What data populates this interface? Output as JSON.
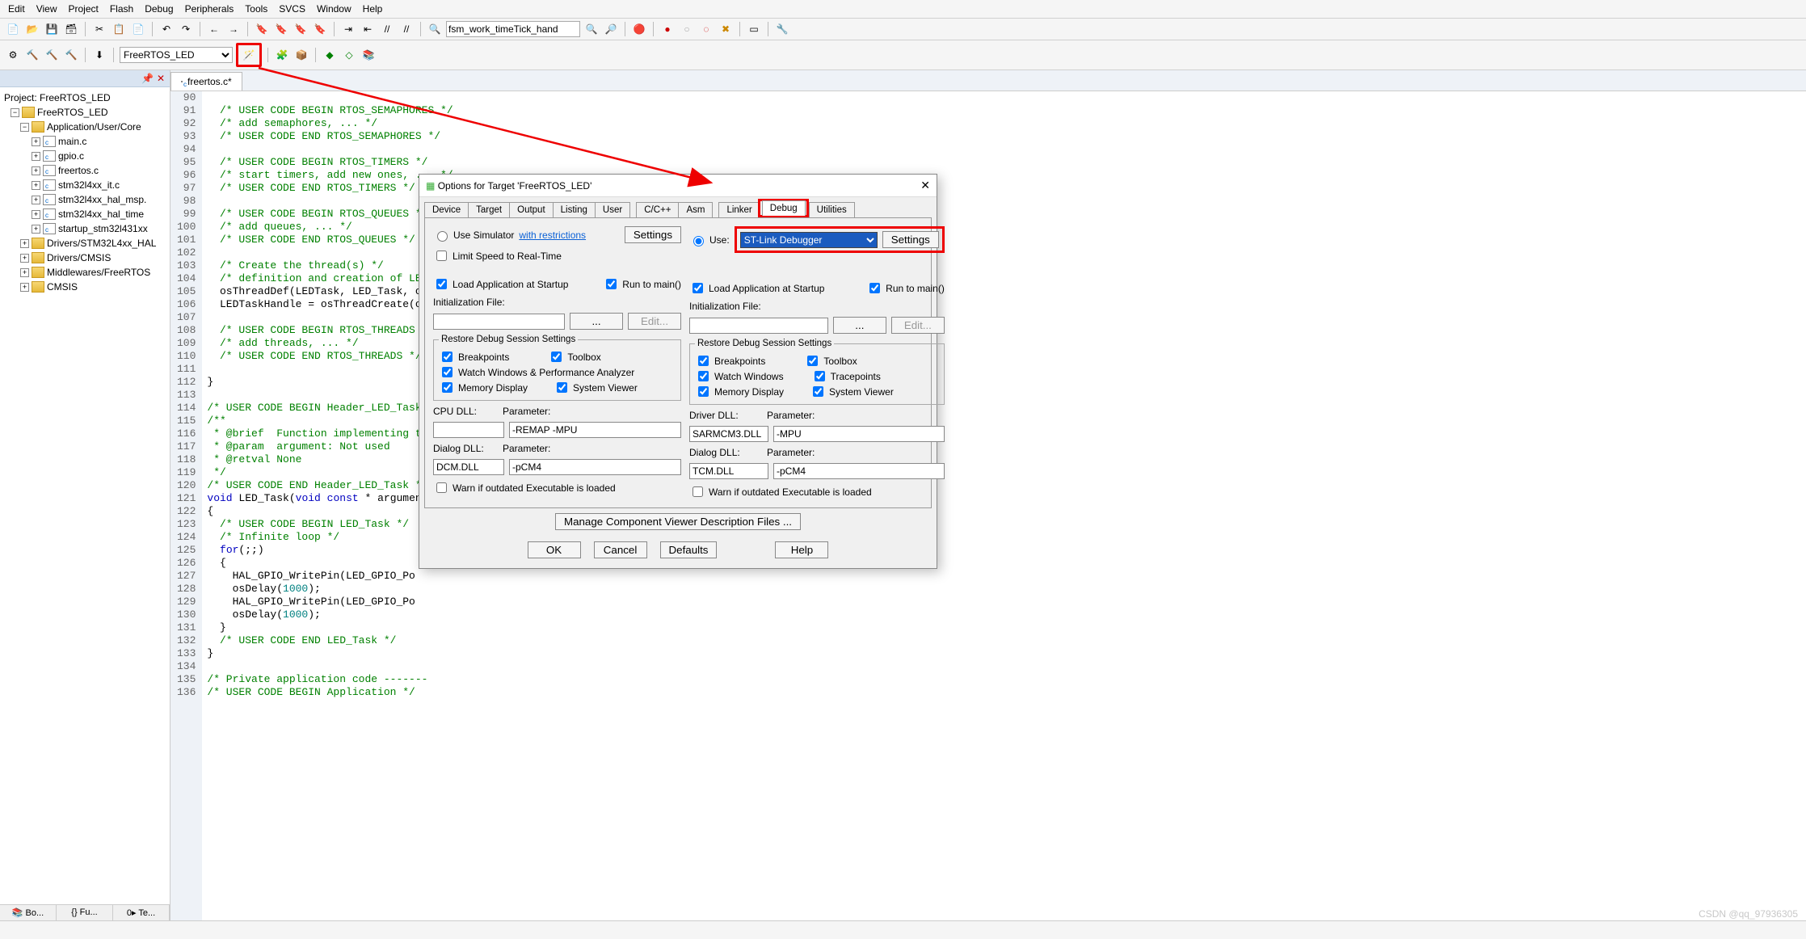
{
  "menu": {
    "items": [
      "Edit",
      "View",
      "Project",
      "Flash",
      "Debug",
      "Peripherals",
      "Tools",
      "SVCS",
      "Window",
      "Help"
    ]
  },
  "symbol_box": "fsm_work_timeTick_hand",
  "target_select": "FreeRTOS_LED",
  "project_title": "Project: FreeRTOS_LED",
  "tree": {
    "root": "FreeRTOS_LED",
    "app_folder": "Application/User/Core",
    "files": [
      "main.c",
      "gpio.c",
      "freertos.c",
      "stm32l4xx_it.c",
      "stm32l4xx_hal_msp.",
      "stm32l4xx_hal_time",
      "startup_stm32l431xx"
    ],
    "folders2": [
      "Drivers/STM32L4xx_HAL",
      "Drivers/CMSIS",
      "Middlewares/FreeRTOS",
      "CMSIS"
    ]
  },
  "left_tabs": [
    "📚 Bo...",
    "{} Fu...",
    "0▸ Te..."
  ],
  "filetab": "freertos.c*",
  "code_start_line": 90,
  "code_lines": [
    "",
    "  /* USER CODE BEGIN RTOS_SEMAPHORES */",
    "  /* add semaphores, ... */",
    "  /* USER CODE END RTOS_SEMAPHORES */",
    "",
    "  /* USER CODE BEGIN RTOS_TIMERS */",
    "  /* start timers, add new ones, ... */",
    "  /* USER CODE END RTOS_TIMERS */",
    "",
    "  /* USER CODE BEGIN RTOS_QUEUES */",
    "  /* add queues, ... */",
    "  /* USER CODE END RTOS_QUEUES */",
    "",
    "  /* Create the thread(s) */",
    "  /* definition and creation of LED",
    "  osThreadDef(LEDTask, LED_Task, os",
    "  LEDTaskHandle = osThreadCreate(os",
    "",
    "  /* USER CODE BEGIN RTOS_THREADS */",
    "  /* add threads, ... */",
    "  /* USER CODE END RTOS_THREADS */",
    "",
    "}",
    "",
    "/* USER CODE BEGIN Header_LED_Task",
    "/**",
    " * @brief  Function implementing th",
    " * @param  argument: Not used",
    " * @retval None",
    " */",
    "/* USER CODE END Header_LED_Task */",
    "void LED_Task(void const * argument",
    "{",
    "  /* USER CODE BEGIN LED_Task */",
    "  /* Infinite loop */",
    "  for(;;)",
    "  {",
    "    HAL_GPIO_WritePin(LED_GPIO_Po",
    "    osDelay(1000);",
    "    HAL_GPIO_WritePin(LED_GPIO_Po",
    "    osDelay(1000);",
    "  }",
    "  /* USER CODE END LED_Task */",
    "}",
    "",
    "/* Private application code -------",
    "/* USER CODE BEGIN Application */"
  ],
  "dialog": {
    "title": "Options for Target 'FreeRTOS_LED'",
    "tabs": [
      "Device",
      "Target",
      "Output",
      "Listing",
      "User",
      "C/C++",
      "Asm",
      "Linker",
      "Debug",
      "Utilities"
    ],
    "active_tab": "Debug",
    "left": {
      "use_sim": "Use Simulator",
      "restrictions": "with restrictions",
      "settings": "Settings",
      "limit": "Limit Speed to Real-Time",
      "load_app": "Load Application at Startup",
      "run_main": "Run to main()",
      "init_file": "Initialization File:",
      "edit": "Edit...",
      "restore": "Restore Debug Session Settings",
      "bp": "Breakpoints",
      "tb": "Toolbox",
      "ww": "Watch Windows & Performance Analyzer",
      "mem": "Memory Display",
      "sv": "System Viewer",
      "cpu_dll": "CPU DLL:",
      "param": "Parameter:",
      "cpu_dll_val": "",
      "cpu_param_val": "-REMAP -MPU",
      "dlg_dll": "Dialog DLL:",
      "dlg_dll_val": "DCM.DLL",
      "dlg_param_val": "-pCM4",
      "warn": "Warn if outdated Executable is loaded"
    },
    "right": {
      "use": "Use:",
      "debugger": "ST-Link Debugger",
      "settings": "Settings",
      "load_app": "Load Application at Startup",
      "run_main": "Run to main()",
      "init_file": "Initialization File:",
      "edit": "Edit...",
      "restore": "Restore Debug Session Settings",
      "bp": "Breakpoints",
      "tb": "Toolbox",
      "ww": "Watch Windows",
      "tp": "Tracepoints",
      "mem": "Memory Display",
      "sv": "System Viewer",
      "drv_dll": "Driver DLL:",
      "param": "Parameter:",
      "drv_dll_val": "SARMCM3.DLL",
      "drv_param_val": "-MPU",
      "dlg_dll": "Dialog DLL:",
      "dlg_dll_val": "TCM.DLL",
      "dlg_param_val": "-pCM4",
      "warn": "Warn if outdated Executable is loaded"
    },
    "manage": "Manage Component Viewer Description Files ...",
    "buttons": {
      "ok": "OK",
      "cancel": "Cancel",
      "defaults": "Defaults",
      "help": "Help"
    }
  },
  "watermark": "CSDN @qq_97936305"
}
